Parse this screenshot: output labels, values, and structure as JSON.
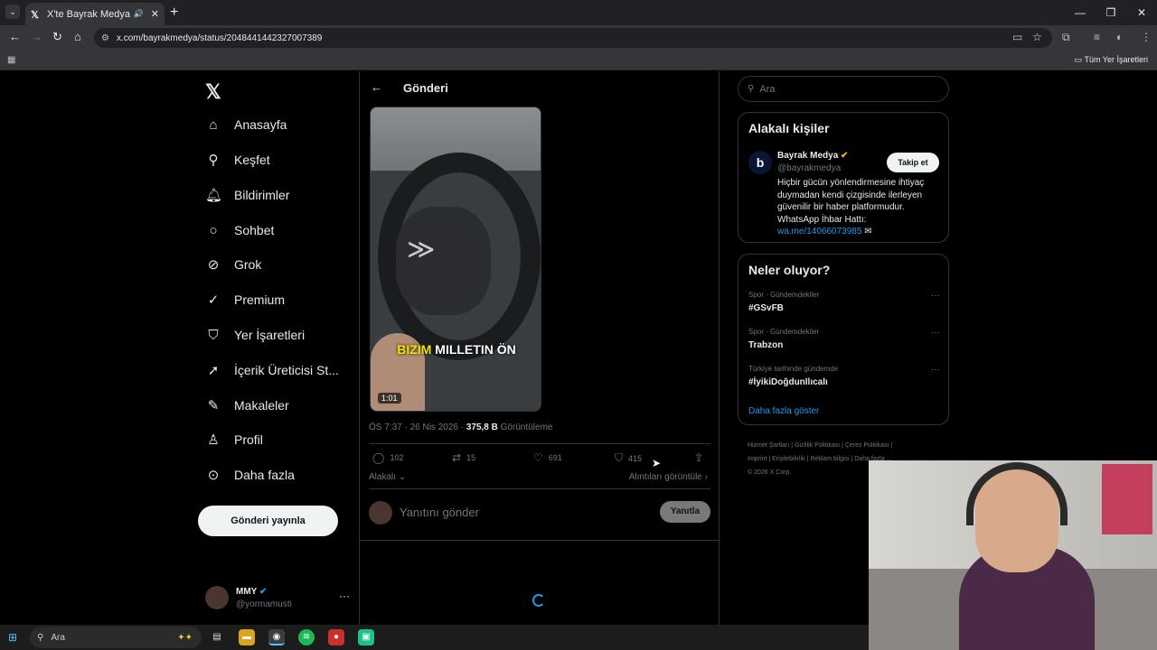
{
  "browser": {
    "tab_title": "X'te Bayrak Medya: \"Uygun",
    "url": "x.com/bayrakmedya/status/2048441442327007389",
    "bookmarks_all": "Tüm Yer İşaretleri"
  },
  "nav": {
    "items": [
      {
        "label": "Anasayfa",
        "icon": "home-icon"
      },
      {
        "label": "Keşfet",
        "icon": "search-icon"
      },
      {
        "label": "Bildirimler",
        "icon": "bell-icon"
      },
      {
        "label": "Sohbet",
        "icon": "chat-icon"
      },
      {
        "label": "Grok",
        "icon": "grok-icon"
      },
      {
        "label": "Premium",
        "icon": "premium-icon"
      },
      {
        "label": "Yer İşaretleri",
        "icon": "bookmark-icon"
      },
      {
        "label": "İçerik Üreticisi St...",
        "icon": "rocket-icon"
      },
      {
        "label": "Makaleler",
        "icon": "article-icon"
      },
      {
        "label": "Profil",
        "icon": "profile-icon"
      },
      {
        "label": "Daha fazla",
        "icon": "more-icon"
      }
    ],
    "post_button": "Gönderi yayınla",
    "account": {
      "name": "MMY",
      "handle": "@yormamusti"
    }
  },
  "post": {
    "header_title": "Gönderi",
    "video_caption_highlight": "BIZIM",
    "video_caption_rest": "MILLETIN ÖN",
    "video_duration": "1:01",
    "time": "ÖS 7:37 · 26 Nis 2026 · ",
    "views_count": "375,8 B",
    "views_label": " Görüntüleme",
    "replies": "102",
    "reposts": "15",
    "likes": "691",
    "bookmarks": "415",
    "related": "Alakalı",
    "quotes_link": "Alıntıları görüntüle",
    "reply_placeholder": "Yanıtını gönder",
    "reply_button": "Yanıtla"
  },
  "sidebar": {
    "search_placeholder": "Ara",
    "relevant": {
      "title": "Alakalı kişiler",
      "name": "Bayrak Medya",
      "handle": "@bayrakmedya",
      "follow": "Takip et",
      "bio": "Hiçbir gücün yönlendirmesine ihtiyaç duymadan kendi çizgisinde ilerleyen güvenilir bir haber platformudur. WhatsApp İhbar Hattı:",
      "link": "wa.me/14066073985"
    },
    "trends": {
      "title": "Neler oluyor?",
      "items": [
        {
          "context": "Spor · Gündemdekiler",
          "topic": "#GSvFB"
        },
        {
          "context": "Spor · Gündemdekiler",
          "topic": "Trabzon"
        },
        {
          "context": "Türkiye tarihinde gündemde",
          "topic": "#İyikiDoğdunIlıcalı"
        }
      ],
      "show_more": "Daha fazla göster"
    },
    "footer": {
      "line1": "Hizmet Şartları  |  Gizlilik Politikası  |  Çerez Politikası  |",
      "line2": "Imprint  |  Erişilebilirlik  |  Reklam bilgisi  |  Daha fazla ...",
      "line3": "© 2026 X Corp."
    }
  },
  "taskbar": {
    "search": "Ara"
  },
  "colors": {
    "accent": "#1d9bf0",
    "background": "#000000",
    "border": "#2f3336"
  }
}
